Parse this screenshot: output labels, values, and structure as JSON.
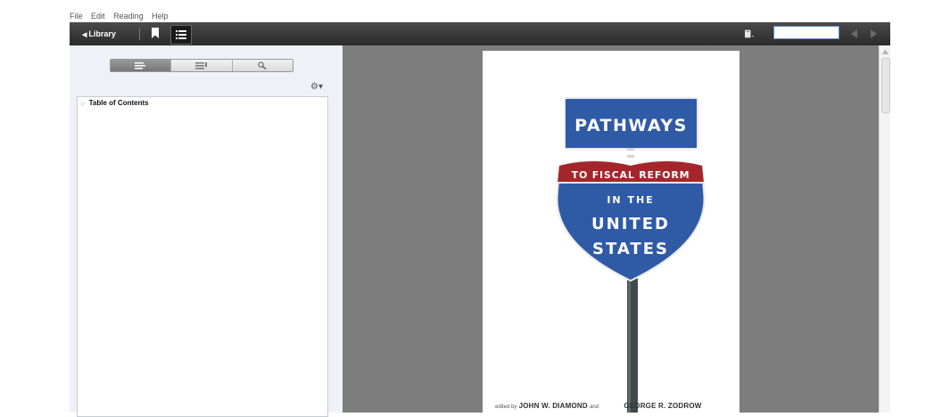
{
  "menu": [
    "File",
    "Edit",
    "Reading",
    "Help"
  ],
  "toolbar": {
    "library_label": "Library",
    "page_number_value": ""
  },
  "sidebar": {
    "toc_title": "Table of Contents"
  },
  "book": {
    "title_line1": "PATHWAYS",
    "title_line2": "TO FISCAL REFORM",
    "title_line3": "IN THE",
    "title_line4": "UNITED",
    "title_line5": "STATES",
    "credit_prefix": "edited by",
    "editor1": "JOHN W. DIAMOND",
    "credit_and": "and",
    "editor2": "GEORGE R. ZODROW"
  },
  "colors": {
    "toolbar": "#333333",
    "sidebar_bg": "#eef2f8",
    "viewer_bg": "#7d7d7d",
    "sign_blue": "#2f5aa6",
    "sign_red": "#a4262c",
    "pole": "#3e4a4b"
  },
  "icons": [
    "bookmark-icon",
    "toc-list-icon",
    "page-layout-icon",
    "prev-page-icon",
    "next-page-icon",
    "search-icon",
    "gear-icon"
  ]
}
